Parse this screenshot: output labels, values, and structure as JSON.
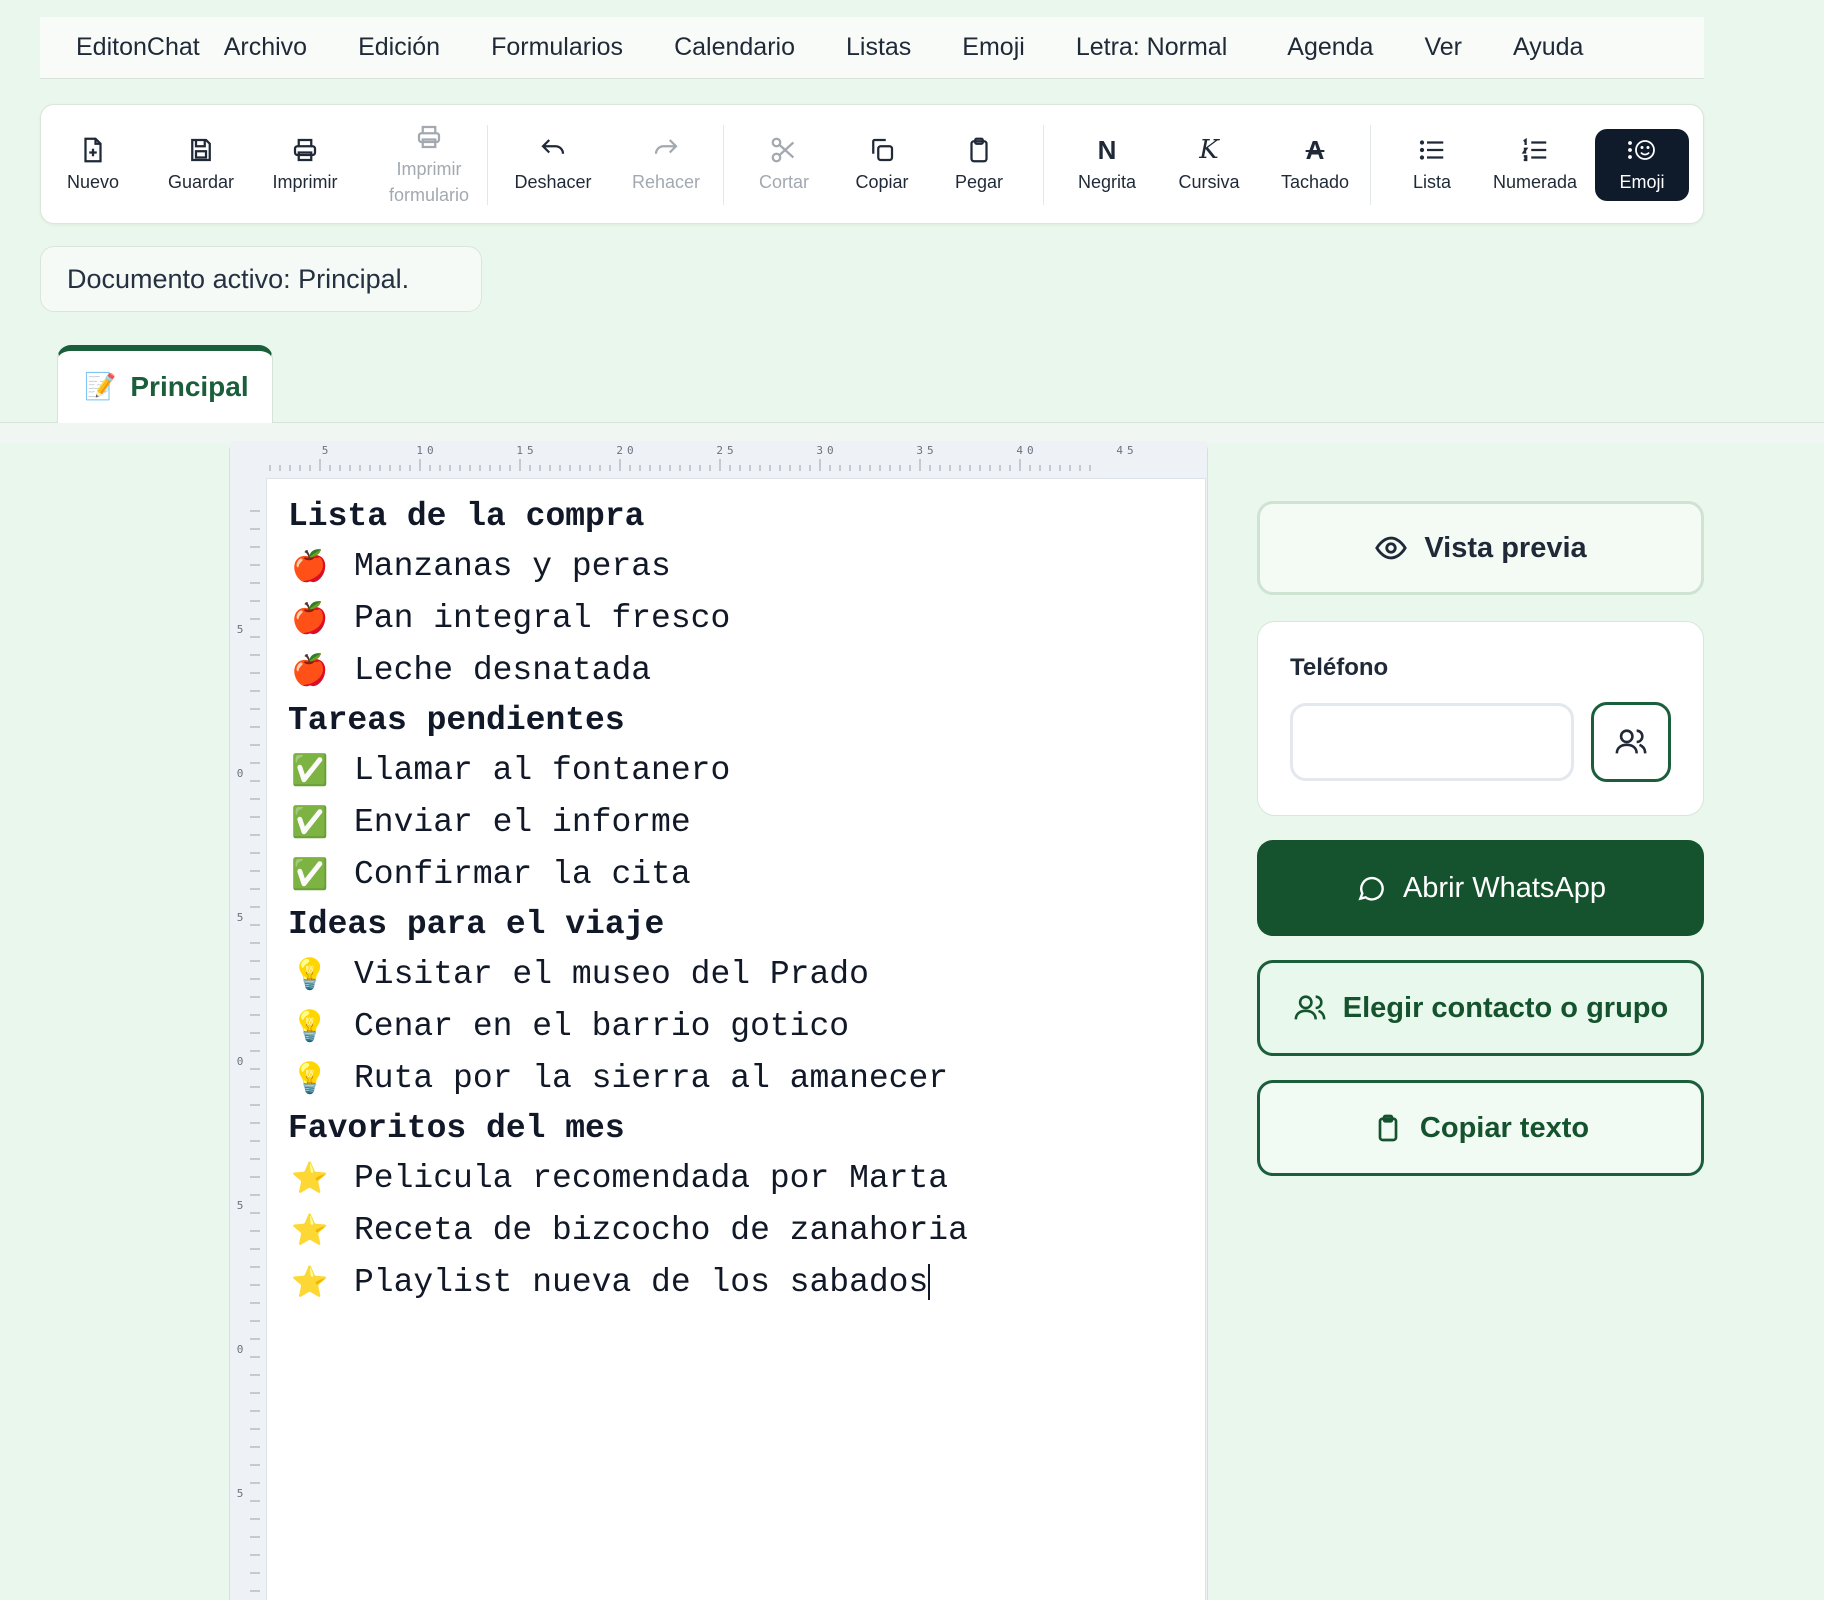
{
  "menubar": {
    "brand": "EditonChat",
    "items": [
      "Archivo",
      "Edición",
      "Formularios",
      "Calendario",
      "Listas",
      "Emoji",
      "Letra: Normal",
      "Agenda",
      "Ver",
      "Ayuda"
    ]
  },
  "toolbar": {
    "nuevo": "Nuevo",
    "guardar": "Guardar",
    "imprimir": "Imprimir",
    "imprimir_form_1": "Imprimir",
    "imprimir_form_2": "formulario",
    "deshacer": "Deshacer",
    "rehacer": "Rehacer",
    "cortar": "Cortar",
    "copiar": "Copiar",
    "pegar": "Pegar",
    "negrita_glyph": "N",
    "negrita": "Negrita",
    "cursiva_glyph": "K",
    "cursiva": "Cursiva",
    "tachado_glyph": "A",
    "tachado": "Tachado",
    "lista": "Lista",
    "numerada": "Numerada",
    "emoji": "Emoji"
  },
  "status": {
    "text": "Documento activo: Principal."
  },
  "tabs": [
    {
      "icon": "📝",
      "label": "Principal"
    }
  ],
  "ruler": {
    "horizontal": [
      "5",
      "10",
      "15",
      "20",
      "25",
      "30",
      "35",
      "40",
      "45"
    ],
    "vertical": [
      "5",
      "0",
      "5",
      "0",
      "5",
      "0",
      "5"
    ]
  },
  "document": {
    "lines": [
      {
        "kind": "heading",
        "text": "Lista de la compra"
      },
      {
        "kind": "item",
        "emoji": "🍎",
        "text": "Manzanas y peras"
      },
      {
        "kind": "item",
        "emoji": "🍎",
        "text": "Pan integral fresco"
      },
      {
        "kind": "item",
        "emoji": "🍎",
        "text": "Leche desnatada"
      },
      {
        "kind": "heading",
        "text": "Tareas pendientes"
      },
      {
        "kind": "item",
        "emoji": "✅",
        "text": "Llamar al fontanero"
      },
      {
        "kind": "item",
        "emoji": "✅",
        "text": "Enviar el informe"
      },
      {
        "kind": "item",
        "emoji": "✅",
        "text": "Confirmar la cita"
      },
      {
        "kind": "heading",
        "text": "Ideas para el viaje"
      },
      {
        "kind": "item",
        "emoji": "💡",
        "text": "Visitar el museo del Prado"
      },
      {
        "kind": "item",
        "emoji": "💡",
        "text": "Cenar en el barrio gotico"
      },
      {
        "kind": "item",
        "emoji": "💡",
        "text": "Ruta por la sierra al amanecer"
      },
      {
        "kind": "heading",
        "text": "Favoritos del mes"
      },
      {
        "kind": "item",
        "emoji": "⭐",
        "text": "Pelicula recomendada por Marta"
      },
      {
        "kind": "item",
        "emoji": "⭐",
        "text": "Receta de bizcocho de zanahoria"
      },
      {
        "kind": "item",
        "emoji": "⭐",
        "text": "Playlist nueva de los sabados"
      }
    ]
  },
  "panel": {
    "preview_label": "Vista previa",
    "phone_label": "Teléfono",
    "phone_value": "",
    "whatsapp_label": "Abrir WhatsApp",
    "choose_label": "Elegir contacto o grupo",
    "copy_label": "Copiar texto"
  },
  "colors": {
    "background": "#eaf7ec",
    "primary_green": "#14532d",
    "accent_green": "#1b5e3b",
    "active_tool": "#0f1a2b"
  }
}
